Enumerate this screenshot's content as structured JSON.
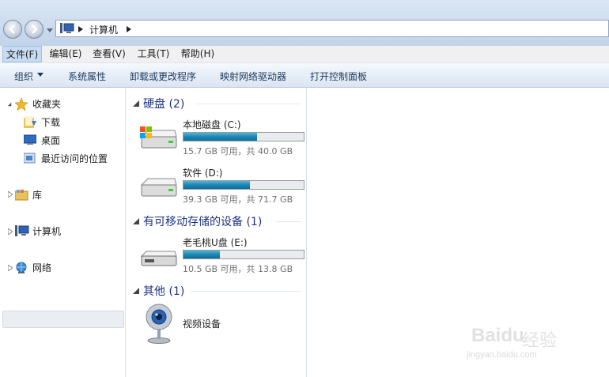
{
  "address": {
    "crumb": "计算机"
  },
  "menubar": [
    "文件(F)",
    "编辑(E)",
    "查看(V)",
    "工具(T)",
    "帮助(H)"
  ],
  "toolbar": {
    "organize": "组织",
    "system_properties": "系统属性",
    "uninstall": "卸载或更改程序",
    "map_drive": "映射网络驱动器",
    "control_panel": "打开控制面板"
  },
  "nav": {
    "favorites": "收藏夹",
    "downloads": "下载",
    "desktop": "桌面",
    "recent": "最近访问的位置",
    "libraries": "库",
    "computer": "计算机",
    "network": "网络"
  },
  "groups": {
    "hdd": "硬盘 (2)",
    "removable": "有可移动存储的设备 (1)",
    "other": "其他 (1)"
  },
  "drives": [
    {
      "name": "本地磁盘 (C:)",
      "info": "15.7 GB 可用，共 40.0 GB",
      "used_fraction": 0.61
    },
    {
      "name": "软件 (D:)",
      "info": "39.3 GB 可用，共 71.7 GB",
      "used_fraction": 0.55
    },
    {
      "name": "老毛桃U盘 (E:)",
      "info": "10.5 GB 可用，共 13.8 GB",
      "used_fraction": 0.3
    }
  ],
  "other_device": "视频设备",
  "watermark": {
    "brand": "Baidu",
    "cn": "经验",
    "url": "jingyan.baidu.com"
  }
}
